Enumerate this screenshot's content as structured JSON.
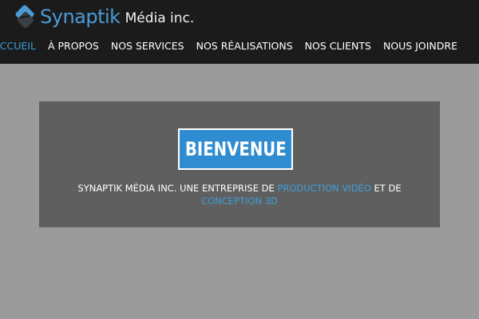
{
  "brand": {
    "name": "Synaptik",
    "suffix": "Média inc.",
    "logo_icon": "synaptik-logo-mark-icon",
    "accent_color": "#4a9bd6"
  },
  "nav": {
    "items": [
      {
        "label": "ACCUEIL",
        "active": true
      },
      {
        "label": "À PROPOS",
        "active": false
      },
      {
        "label": "NOS SERVICES",
        "active": false
      },
      {
        "label": "NOS RÉALISATIONS",
        "active": false
      },
      {
        "label": "NOS CLIENTS",
        "active": false
      },
      {
        "label": "NOUS JOINDRE",
        "active": false
      }
    ],
    "active_color": "#3d9ed9"
  },
  "hero": {
    "badge_text": "BIENVENUE",
    "badge_color": "#2f8cd0",
    "tagline_part1": "SYNAPTIK MÉDIA INC. UNE ENTREPRISE DE ",
    "tagline_highlight1": "PRODUCTION VIDÉO",
    "tagline_part2": " ET DE ",
    "tagline_highlight2": "CONCEPTION 3D"
  }
}
